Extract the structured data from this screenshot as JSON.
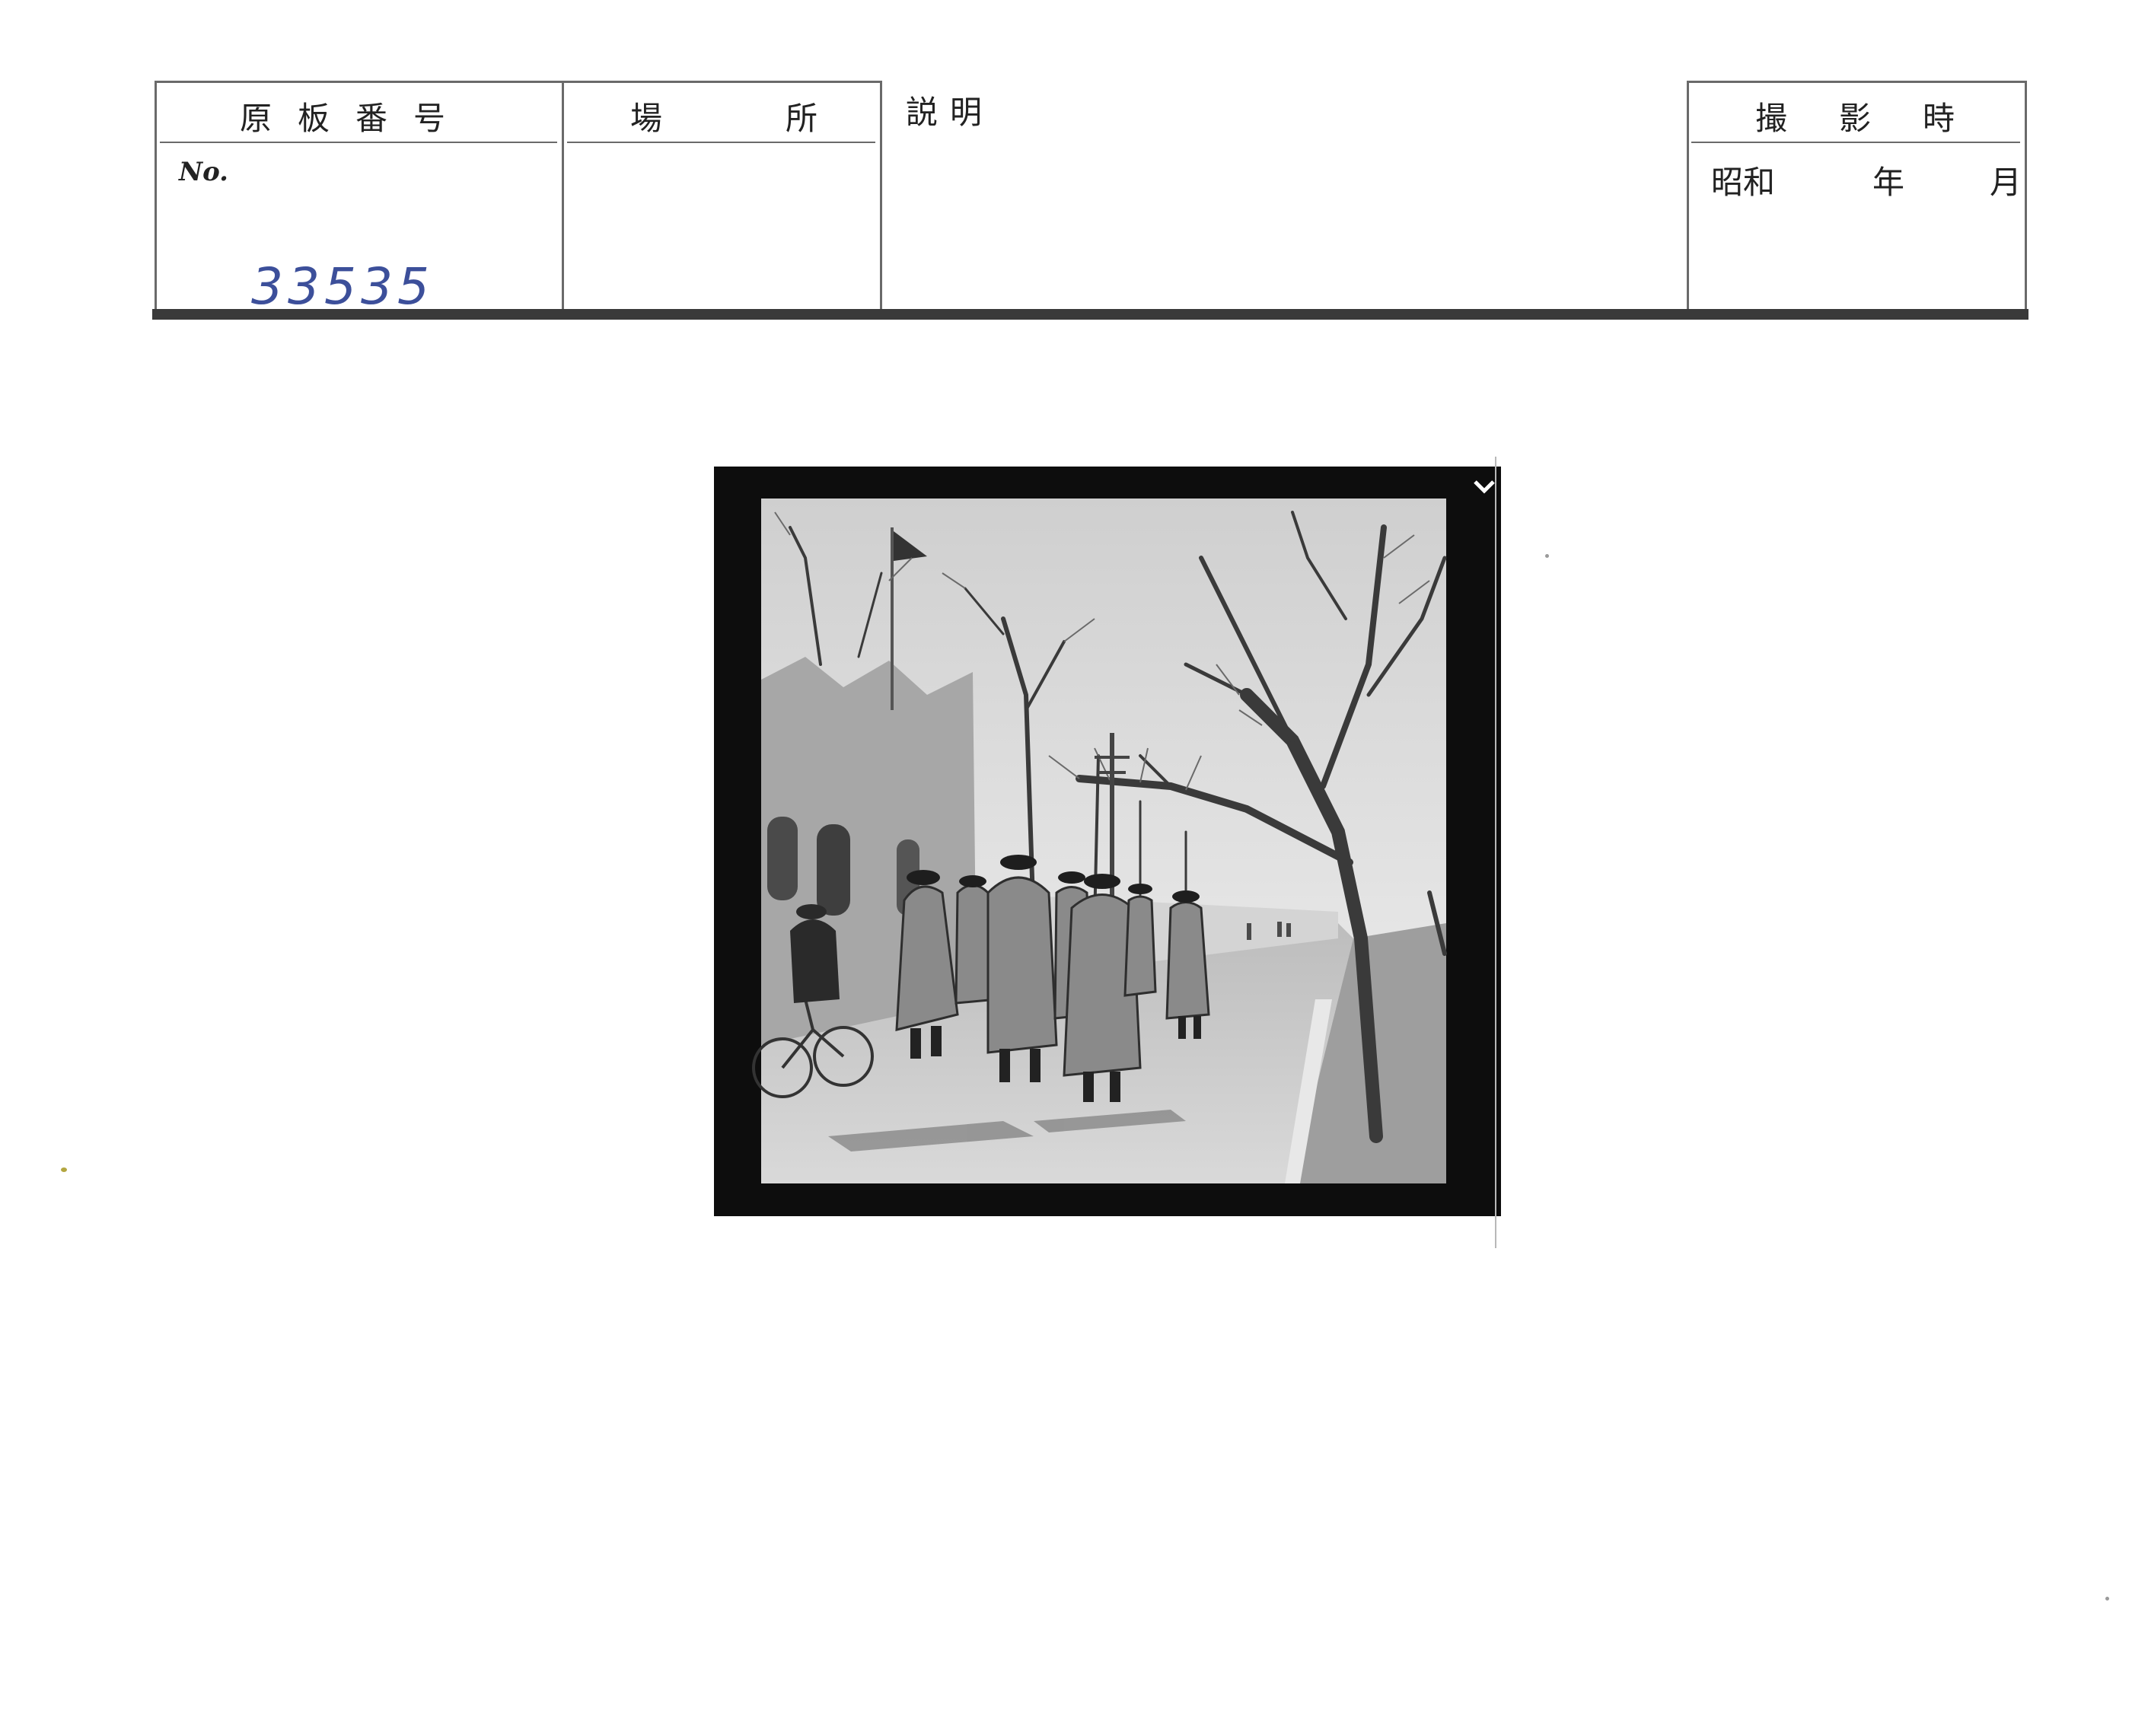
{
  "header": {
    "negative_number_label": "原板番号",
    "location_label": "場　所",
    "description_label": "説明",
    "date_label": "撮影時",
    "no_label": "No.",
    "era_label": "昭和",
    "year_label": "年",
    "month_label": "月"
  },
  "record": {
    "negative_number": "33535"
  },
  "photo": {
    "subject": "soldiers-walking-street-photo"
  }
}
